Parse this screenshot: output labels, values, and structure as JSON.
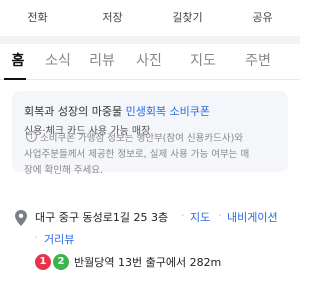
{
  "actions": [
    {
      "label": "전화",
      "icon": "phone-icon"
    },
    {
      "label": "저장",
      "icon": "bookmark-icon"
    },
    {
      "label": "길찾기",
      "icon": "directions-icon"
    },
    {
      "label": "공유",
      "icon": "share-icon"
    }
  ],
  "tabs": [
    "홈",
    "소식",
    "리뷰",
    "사진",
    "지도",
    "주변"
  ],
  "active_tab": "홈",
  "promo": {
    "line1_prefix": "회복과 성장의 마중물",
    "line1_highlight": "민생회복 소비쿠폰",
    "line2": "신용·체크 카드 사용 가능 매장"
  },
  "notice": {
    "icon": "info-icon",
    "line1": "소비쿠폰 가맹점 정보는 행안부(참여 신용카드사)와",
    "line2": "사업주분들께서 제공한 정보로, 실제 사용 가능 여부는 매",
    "line3": "장에 확인해 주세요."
  },
  "address": {
    "icon": "map-pin-icon",
    "text": "대구 중구 동성로1길 25 3층",
    "map_link": "지도",
    "nav_link": "내비게이션",
    "street_link": "거리뷰"
  },
  "transit": {
    "lines": [
      "1",
      "2"
    ],
    "colors": [
      "#e8334c",
      "#3ab54a"
    ],
    "text": "반월당역 13번 출구에서 282m"
  },
  "colors": {
    "accent": "#2b6ae8"
  }
}
